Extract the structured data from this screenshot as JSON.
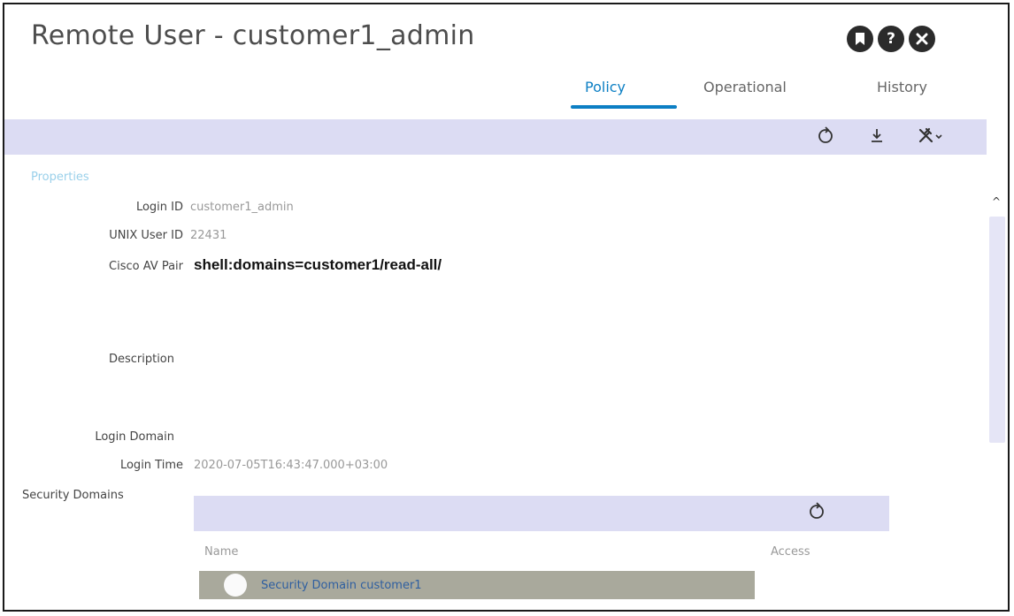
{
  "window": {
    "title": "Remote User - customer1_admin",
    "icons": [
      "bookmark-icon",
      "help-icon",
      "close-icon"
    ]
  },
  "tabs": [
    {
      "label": "Policy",
      "active": true
    },
    {
      "label": "Operational",
      "active": false
    },
    {
      "label": "History",
      "active": false
    }
  ],
  "toolbar": {
    "icons": [
      "refresh-icon",
      "download-icon",
      "tools-icon"
    ]
  },
  "properties": {
    "section_label": "Properties",
    "login_id": {
      "label": "Login ID",
      "value": "customer1_admin"
    },
    "unix_user_id": {
      "label": "UNIX User ID",
      "value": "22431"
    },
    "cisco_av_pair": {
      "label": "Cisco AV Pair",
      "value": "shell:domains=customer1/read-all/"
    },
    "description": {
      "label": "Description",
      "value": ""
    },
    "login_domain": {
      "label": "Login Domain",
      "value": ""
    },
    "login_time": {
      "label": "Login Time",
      "value": "2020-07-05T16:43:47.000+03:00"
    }
  },
  "security_domains": {
    "label": "Security Domains",
    "columns": [
      "Name",
      "Access"
    ],
    "rows": [
      {
        "name": "Security Domain customer1",
        "access": ""
      }
    ]
  },
  "colors": {
    "accent": "#0c7fc4",
    "toolbar_bg": "#dcdcf3",
    "selected_row_bg": "#a9a99c"
  }
}
